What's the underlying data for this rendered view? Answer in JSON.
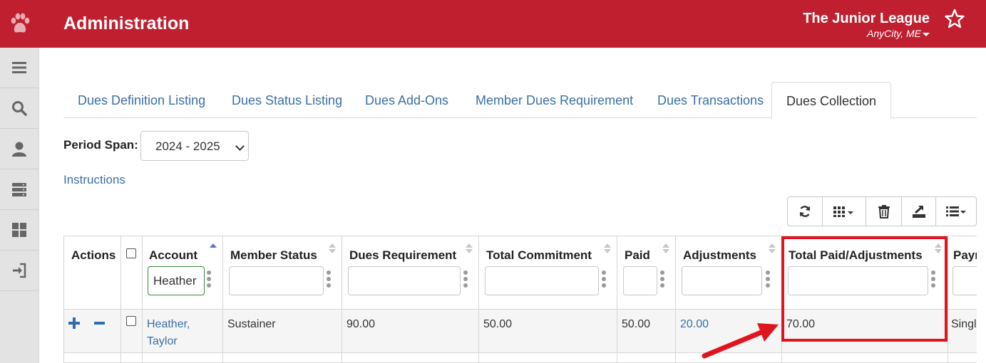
{
  "header": {
    "title": "Administration",
    "org_name": "The Junior League",
    "org_city": "AnyCity, ME",
    "brand_color": "#c01f2f"
  },
  "sidebar": {
    "items": [
      {
        "icon": "menu-icon"
      },
      {
        "icon": "search-icon"
      },
      {
        "icon": "user-icon"
      },
      {
        "icon": "server-icon"
      },
      {
        "icon": "dashboard-icon"
      },
      {
        "icon": "sign-in-icon"
      }
    ]
  },
  "tabs": [
    {
      "label": "Dues Definition Listing",
      "active": false
    },
    {
      "label": "Dues Status Listing",
      "active": false
    },
    {
      "label": "Dues Add-Ons",
      "active": false
    },
    {
      "label": "Member Dues Requirement",
      "active": false
    },
    {
      "label": "Dues Transactions",
      "active": false
    },
    {
      "label": "Dues Collection",
      "active": true
    }
  ],
  "period": {
    "label": "Period Span:",
    "value": "2024 - 2025"
  },
  "instructions_link": "Instructions",
  "toolbar": {
    "buttons": [
      "refresh-icon",
      "columns-icon",
      "trash-icon",
      "export-icon",
      "list-icon"
    ]
  },
  "table": {
    "headers": {
      "actions": "Actions",
      "account": "Account",
      "member_status": "Member Status",
      "dues_requirement": "Dues Requirement",
      "total_commitment": "Total Commitment",
      "paid": "Paid",
      "adjustments": "Adjustments",
      "total_paid_adjustments": "Total Paid/Adjustments",
      "payment": "Payn"
    },
    "filters": {
      "account": "Heather"
    },
    "row": {
      "account_line1": "Heather,",
      "account_line2": "Taylor",
      "member_status": "Sustainer",
      "dues_requirement": "90.00",
      "total_commitment": "50.00",
      "paid": "50.00",
      "adjustments": "20.00",
      "total_paid_adjustments": "70.00",
      "payment": "Singl"
    }
  },
  "annotation_color": "#e0141e"
}
